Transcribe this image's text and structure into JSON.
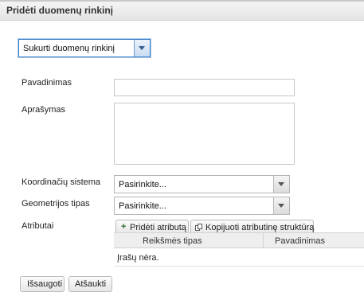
{
  "window": {
    "title": "Pridėti duomenų rinkinį"
  },
  "mode_select": {
    "value": "Sukurti duomenų rinkinį"
  },
  "form": {
    "name_label": "Pavadinimas",
    "name_value": "",
    "description_label": "Aprašymas",
    "description_value": "",
    "crs_label": "Koordinačių sistema",
    "crs_value": "Pasirinkite...",
    "geometry_label": "Geometrijos tipas",
    "geometry_value": "Pasirinkite...",
    "attributes_label": "Atributai"
  },
  "attributes": {
    "add_button_label": "Pridėti atributą",
    "copy_button_label": "Kopijuoti atributinę struktūrą",
    "columns": [
      "Reikšmės tipas",
      "Pavadinimas"
    ],
    "empty_text": "Įrašų nėra."
  },
  "footer": {
    "save_label": "Išsaugoti",
    "cancel_label": "Atšaukti"
  },
  "icons": {
    "dropdown": "chevron-down-icon",
    "add": "plus-icon",
    "copy": "copy-icon"
  }
}
